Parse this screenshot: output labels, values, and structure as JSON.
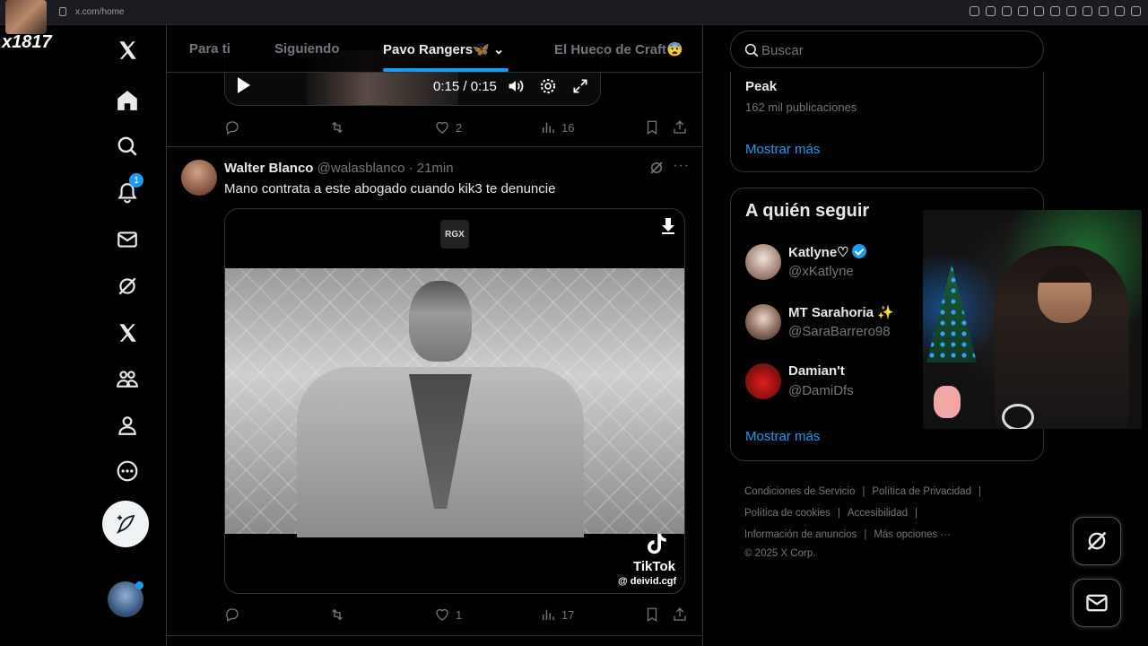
{
  "browser": {
    "url": "x.com/home"
  },
  "stream_overlay": {
    "tag": "x1817"
  },
  "nav": {
    "notification_count": "1"
  },
  "tabs": [
    {
      "label": "Para ti"
    },
    {
      "label": "Siguiendo"
    },
    {
      "label": "Pavo Rangers🦋 ⌄"
    },
    {
      "label": "El Hueco de Craft😨"
    }
  ],
  "prev_post": {
    "time": "0:15 / 0:15",
    "likes": "2",
    "views": "16"
  },
  "tweet": {
    "name": "Walter Blanco",
    "handle": "@walasblanco · 21min",
    "text": "Mano contrata a este abogado cuando kik3 te denuncie",
    "media_badge": "RGX",
    "watermark_brand": "TikTok",
    "watermark_user": "@ deivid.cgf",
    "likes": "1",
    "views": "17"
  },
  "search": {
    "placeholder": "Buscar"
  },
  "trend": {
    "title": "Peak",
    "posts": "162 mil publicaciones",
    "show_more": "Mostrar más"
  },
  "who_to_follow": {
    "title": "A quién seguir",
    "users": [
      {
        "name": "Katlyne♡",
        "handle": "@xKatlyne",
        "verified": true
      },
      {
        "name": "MT Sarahoria ✨",
        "handle": "@SaraBarrero98",
        "verified": false
      },
      {
        "name": "Damian't",
        "handle": "@DamiDfs",
        "verified": false
      }
    ],
    "show_more": "Mostrar más"
  },
  "footer": {
    "links": [
      "Condiciones de Servicio",
      "Política de Privacidad",
      "Política de cookies",
      "Accesibilidad",
      "Información de anuncios",
      "Más opciones ···"
    ],
    "copyright": "© 2025 X Corp."
  },
  "colors": {
    "accent": "#1d9bf0",
    "background": "#000000",
    "border": "#2f3336",
    "muted": "#71767b"
  }
}
